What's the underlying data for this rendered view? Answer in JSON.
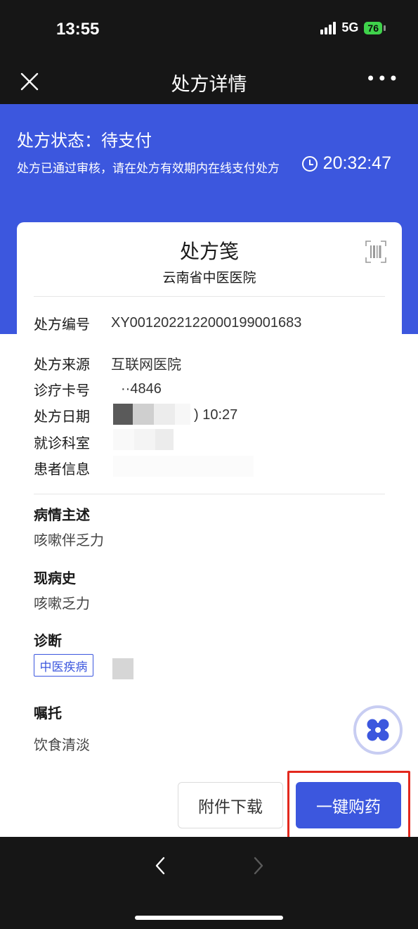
{
  "status_bar": {
    "time": "13:55",
    "network": "5G",
    "battery": "76"
  },
  "nav": {
    "title": "处方详情",
    "more": "•••"
  },
  "banner": {
    "status": "处方状态：待支付",
    "description": "处方已通过审核，请在处方有效期内在线支付处方",
    "countdown": "20:32:47"
  },
  "card": {
    "title": "处方笺",
    "hospital": "云南省中医医院",
    "fields": {
      "rx_number_label": "处方编号",
      "rx_number": "XY0012022122000199001683",
      "source_label": "处方来源",
      "source": "互联网医院",
      "card_no_label": "诊疗卡号",
      "card_no": "··4846",
      "date_label": "处方日期",
      "date": ") 10:27",
      "dept_label": "就诊科室",
      "patient_label": "患者信息"
    },
    "complaint": {
      "title": "病情主述",
      "text": "咳嗽伴乏力"
    },
    "history": {
      "title": "现病史",
      "text": "咳嗽乏力"
    },
    "diagnosis": {
      "title": "诊断",
      "tag": "中医疾病"
    },
    "advice": {
      "title": "嘱托",
      "text": "饮食清淡"
    }
  },
  "actions": {
    "download": "附件下载",
    "buy": "一键购药"
  },
  "colors": {
    "primary": "#3c57de",
    "highlight": "#e3281d",
    "dark": "#161616"
  }
}
